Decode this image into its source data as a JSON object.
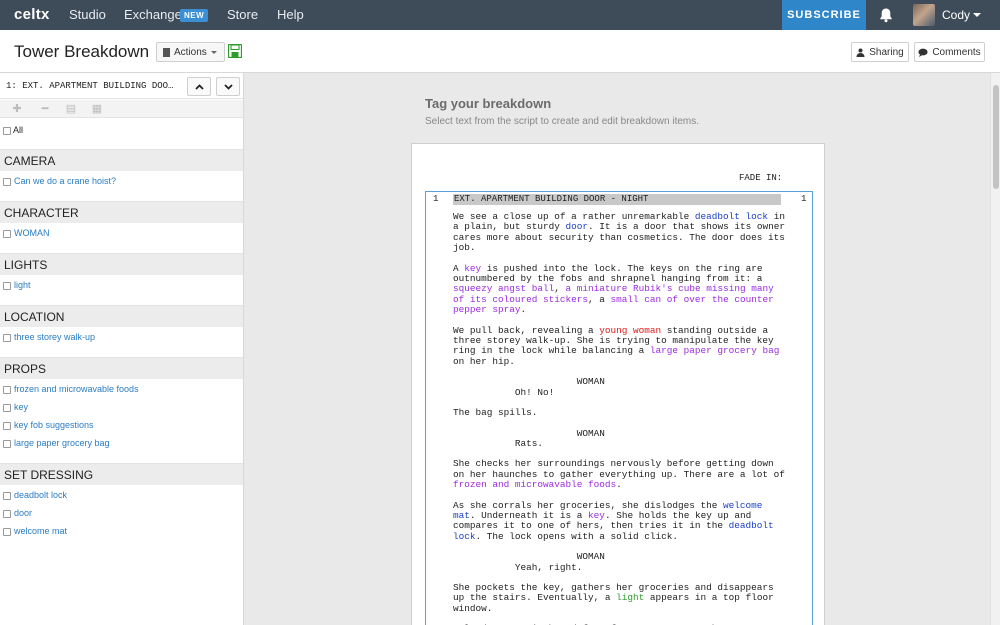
{
  "nav": {
    "brand": "celtx",
    "links": [
      "Studio",
      "Exchange",
      "Store",
      "Help"
    ],
    "new_badge": "NEW",
    "subscribe": "SUBSCRIBE",
    "user": "Cody",
    "icons": [
      "bell-icon",
      "avatar",
      "chevron-down-icon"
    ]
  },
  "header": {
    "title": "Tower Breakdown",
    "actions": "Actions",
    "sharing": "Sharing",
    "comments": "Comments"
  },
  "sidebar": {
    "scene": "1: EXT. APARTMENT BUILDING DOO…",
    "all_label": "All",
    "categories": [
      {
        "name": "CAMERA",
        "items": [
          "Can we do a crane hoist?"
        ]
      },
      {
        "name": "CHARACTER",
        "items": [
          "WOMAN"
        ]
      },
      {
        "name": "LIGHTS",
        "items": [
          "light"
        ]
      },
      {
        "name": "LOCATION",
        "items": [
          "three storey walk-up"
        ]
      },
      {
        "name": "PROPS",
        "items": [
          "frozen and microwavable foods",
          "key",
          "key fob suggestions",
          "large paper grocery bag"
        ]
      },
      {
        "name": "SET DRESSING",
        "items": [
          "deadbolt lock",
          "door",
          "welcome mat"
        ]
      }
    ]
  },
  "main": {
    "heading": "Tag your breakdown",
    "subheading": "Select text from the script to create and edit breakdown items.",
    "fade_in": "FADE IN:",
    "scene_number": "1",
    "slugline": "EXT. APARTMENT BUILDING DOOR - NIGHT"
  },
  "script_blocks": [
    {
      "type": "action",
      "segments": [
        [
          "We see a close up of a rather unremarkable ",
          ""
        ],
        [
          "deadbolt lock",
          "blue"
        ],
        [
          " in\na plain, but sturdy ",
          ""
        ],
        [
          "door",
          "blue"
        ],
        [
          ". It is a door that shows its owner\ncares more about security than cosmetics. The door does its\njob.",
          ""
        ]
      ]
    },
    {
      "type": "action",
      "segments": [
        [
          "A ",
          ""
        ],
        [
          "key",
          "purple"
        ],
        [
          " is pushed into the lock. The keys on the ring are\noutnumbered by the fobs and shrapnel hanging from it: a\n",
          ""
        ],
        [
          "squeezy angst ball",
          "purple"
        ],
        [
          ", ",
          ""
        ],
        [
          "a miniature Rubik's cube missing many\nof its coloured stickers",
          "purple"
        ],
        [
          ", a ",
          ""
        ],
        [
          "small can of over the counter\npepper spray",
          "purple"
        ],
        [
          ".",
          ""
        ]
      ]
    },
    {
      "type": "action",
      "segments": [
        [
          "We pull back, revealing a ",
          ""
        ],
        [
          "young woman",
          "red"
        ],
        [
          " standing outside a\nthree storey walk-up. She is trying to manipulate the key\nring in the lock while balancing a ",
          ""
        ],
        [
          "large paper grocery bag",
          "purple"
        ],
        [
          "\non her hip.",
          ""
        ]
      ]
    },
    {
      "type": "dialogue",
      "segments": [
        [
          "                      WOMAN\n           Oh! No!",
          ""
        ]
      ]
    },
    {
      "type": "action",
      "segments": [
        [
          "The bag spills.",
          ""
        ]
      ]
    },
    {
      "type": "dialogue",
      "segments": [
        [
          "                      WOMAN\n           Rats.",
          ""
        ]
      ]
    },
    {
      "type": "action",
      "segments": [
        [
          "She checks her surroundings nervously before getting down\non her haunches to gather everything up. There are a lot of\n",
          ""
        ],
        [
          "frozen and microwavable foods",
          "purple"
        ],
        [
          ".",
          ""
        ]
      ]
    },
    {
      "type": "action",
      "segments": [
        [
          "As she corrals her groceries, she dislodges the ",
          ""
        ],
        [
          "welcome\nmat",
          "blue"
        ],
        [
          ". Underneath it is a ",
          ""
        ],
        [
          "key",
          "purple"
        ],
        [
          ". She holds the key up and\ncompares it to one of hers, then tries it in the ",
          ""
        ],
        [
          "deadbolt\nlock",
          "blue"
        ],
        [
          ". The lock opens with a solid click.",
          ""
        ]
      ]
    },
    {
      "type": "dialogue",
      "segments": [
        [
          "                      WOMAN\n           Yeah, right.",
          ""
        ]
      ]
    },
    {
      "type": "action",
      "segments": [
        [
          "She pockets the key, gathers her groceries and disappears\nup the stairs. Eventually, a ",
          ""
        ],
        [
          "light",
          "green"
        ],
        [
          " appears in a top floor\nwindow.",
          ""
        ]
      ]
    },
    {
      "type": "action",
      "segments": [
        [
          "A loud report is heard from far away -- a gunshot, a car",
          ""
        ]
      ]
    }
  ],
  "colors": {
    "nav_bg": "#3e4c5a",
    "subscribe": "#2f86c8",
    "link": "#2a7cc4",
    "tag_blue": "#1b3fc7",
    "tag_purple": "#9b2ce0",
    "tag_red": "#e01a1a",
    "tag_green": "#2e9d2e"
  }
}
